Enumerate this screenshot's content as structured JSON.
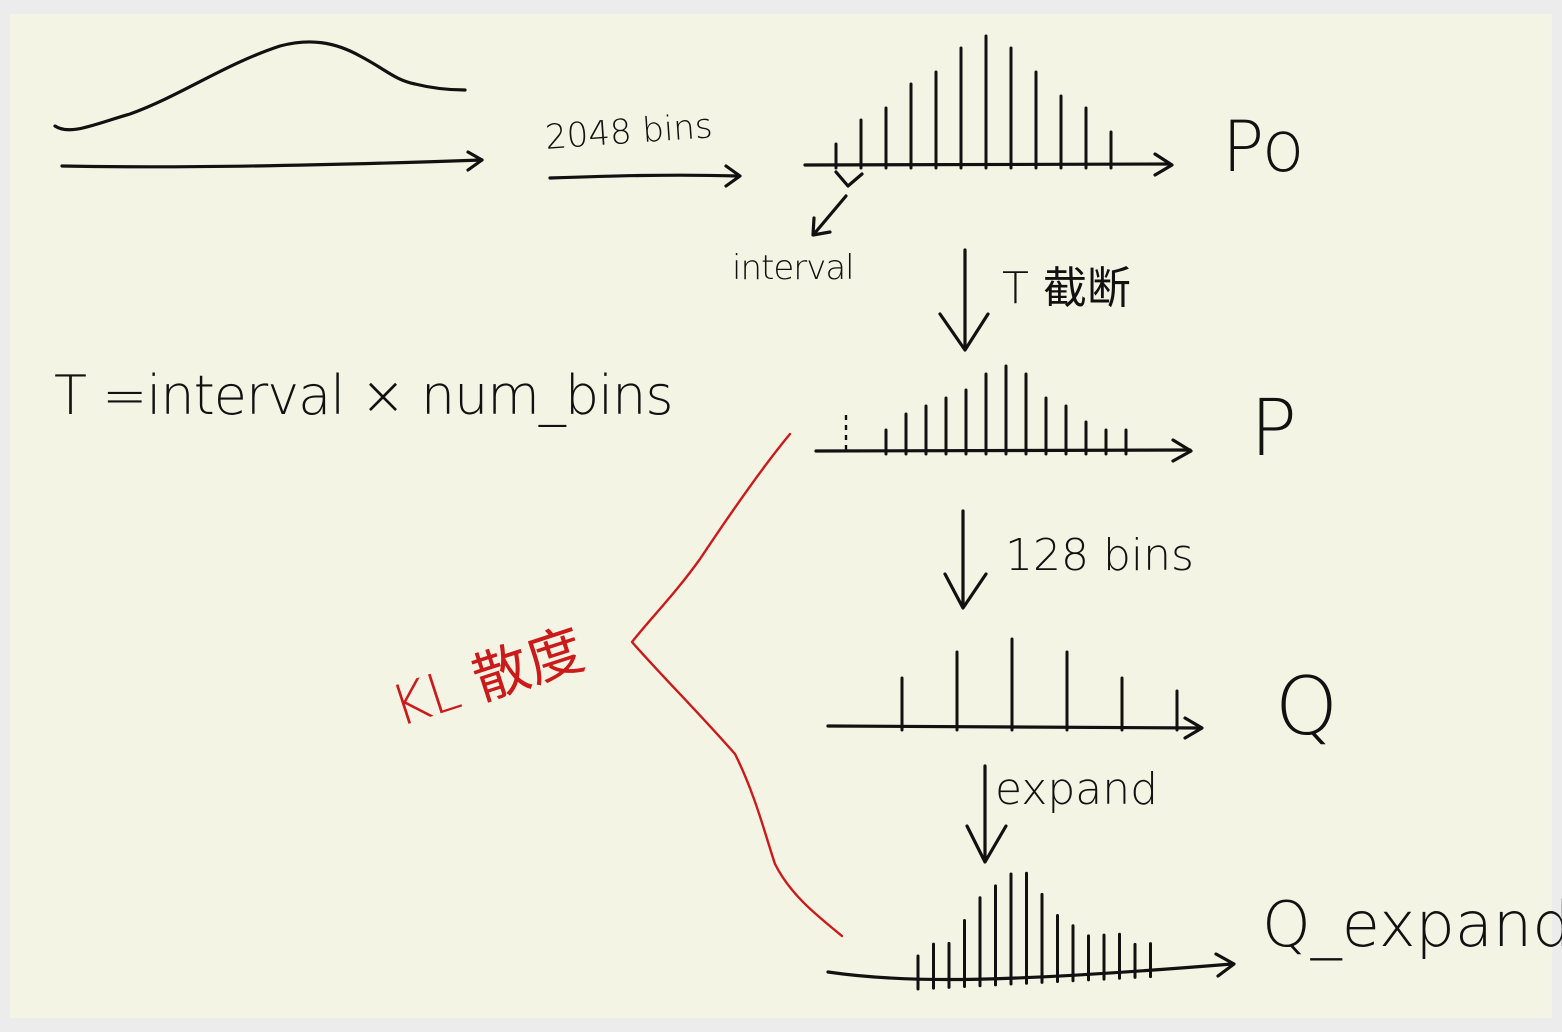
{
  "labels": {
    "bins_2048": "2048 bins",
    "interval": "interval",
    "p0": "Po",
    "truncate": "T 截断",
    "formula": "T =interval × num_bins",
    "p": "P",
    "bins_128": "128 bins",
    "q": "Q",
    "expand": "expand",
    "q_expand": "Q_expand",
    "kl": "KL 散度"
  },
  "histograms": {
    "p0": [
      2,
      4,
      5,
      7,
      8,
      10,
      11,
      10,
      8,
      6,
      5,
      3
    ],
    "p": [
      3,
      5,
      6,
      7,
      8,
      10,
      11,
      10,
      7,
      6,
      4,
      3,
      3
    ],
    "q": [
      4,
      6,
      7,
      6,
      4,
      3
    ],
    "q_expand": [
      3,
      4,
      4,
      6,
      8,
      9,
      10,
      10,
      8,
      6,
      5,
      4,
      4,
      4,
      3,
      3
    ]
  },
  "colors": {
    "ink": "#111111",
    "annotation": "#cc1a1a",
    "paper": "#f4f4e4",
    "frame": "#ececec"
  }
}
